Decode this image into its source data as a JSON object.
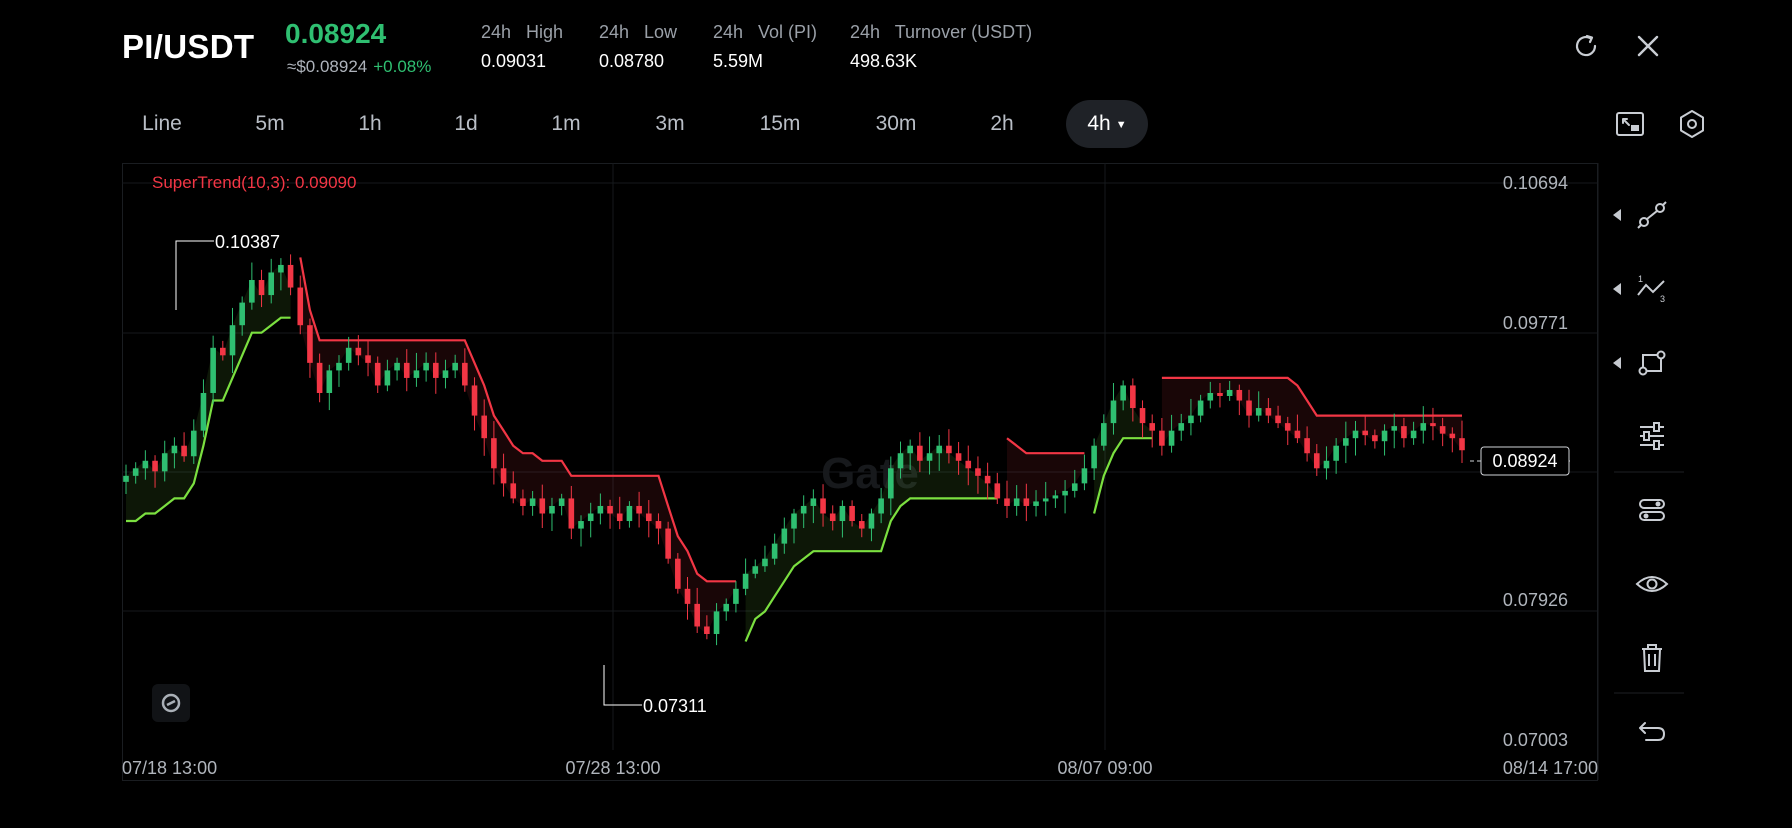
{
  "header": {
    "pair": "PI/USDT",
    "price": "0.08924",
    "usd_price": "≈$0.08924",
    "change": "+0.08%",
    "stats": [
      {
        "label": "24h   High",
        "value": "0.09031"
      },
      {
        "label": "24h   Low",
        "value": "0.08780"
      },
      {
        "label": "24h   Vol (PI)",
        "value": "5.59M"
      },
      {
        "label": "24h   Turnover (USDT)",
        "value": "498.63K"
      }
    ],
    "icons": [
      "refresh-icon",
      "close-icon"
    ]
  },
  "timeframes": [
    "Line",
    "5m",
    "1h",
    "1d",
    "1m",
    "3m",
    "15m",
    "30m",
    "2h",
    "4h"
  ],
  "active_timeframe": "4h",
  "toolbar_icons": [
    "fullscreen-icon",
    "settings-icon"
  ],
  "side_toolbar": [
    "drawing-line-icon",
    "indicator-icon",
    "shape-icon",
    "sliders-icon",
    "layers-icon",
    "eye-icon",
    "trash-icon",
    "undo-icon"
  ],
  "colors": {
    "up": "#2fbf71",
    "down": "#f23645",
    "st_up": "#7be040",
    "st_down": "#f23645",
    "bg": "#000000"
  },
  "chart_data": {
    "type": "candlestick",
    "indicator_label": "SuperTrend(10,3): 0.09090",
    "watermark": "Gate",
    "y_ticks": [
      "0.10694",
      "0.09771",
      "0.07926",
      "0.07003"
    ],
    "x_ticks": [
      "07/18 13:00",
      "07/28 13:00",
      "08/07 09:00",
      "08/14 17:00"
    ],
    "ylim": [
      0.07003,
      0.10694
    ],
    "high_marker": "0.10387",
    "low_marker": "0.07311",
    "last_price": "0.08924",
    "close_series": [
      0.0875,
      0.088,
      0.0885,
      0.0878,
      0.089,
      0.0895,
      0.0888,
      0.0905,
      0.093,
      0.096,
      0.0955,
      0.0975,
      0.099,
      0.1005,
      0.0995,
      0.101,
      0.1015,
      0.1,
      0.0975,
      0.095,
      0.093,
      0.0945,
      0.095,
      0.096,
      0.0955,
      0.095,
      0.0935,
      0.0945,
      0.095,
      0.094,
      0.0945,
      0.095,
      0.094,
      0.0945,
      0.095,
      0.0935,
      0.0915,
      0.09,
      0.088,
      0.087,
      0.086,
      0.0855,
      0.086,
      0.085,
      0.0855,
      0.086,
      0.084,
      0.0845,
      0.085,
      0.0855,
      0.085,
      0.0845,
      0.0855,
      0.085,
      0.0845,
      0.084,
      0.082,
      0.08,
      0.079,
      0.0775,
      0.077,
      0.0785,
      0.079,
      0.08,
      0.081,
      0.0815,
      0.082,
      0.083,
      0.084,
      0.085,
      0.0855,
      0.086,
      0.085,
      0.0845,
      0.0855,
      0.0845,
      0.084,
      0.085,
      0.086,
      0.088,
      0.089,
      0.0895,
      0.0885,
      0.089,
      0.0895,
      0.089,
      0.0885,
      0.088,
      0.0875,
      0.087,
      0.086,
      0.0855,
      0.086,
      0.0855,
      0.0858,
      0.086,
      0.0862,
      0.0865,
      0.087,
      0.088,
      0.0895,
      0.091,
      0.0925,
      0.0935,
      0.092,
      0.091,
      0.0905,
      0.0895,
      0.0905,
      0.091,
      0.0915,
      0.0925,
      0.093,
      0.0928,
      0.0932,
      0.0925,
      0.0915,
      0.092,
      0.0915,
      0.091,
      0.0905,
      0.09,
      0.089,
      0.088,
      0.0885,
      0.0895,
      0.09,
      0.0905,
      0.0902,
      0.0898,
      0.0905,
      0.0908,
      0.09,
      0.0905,
      0.091,
      0.0908,
      0.0903,
      0.09,
      0.0892
    ]
  }
}
